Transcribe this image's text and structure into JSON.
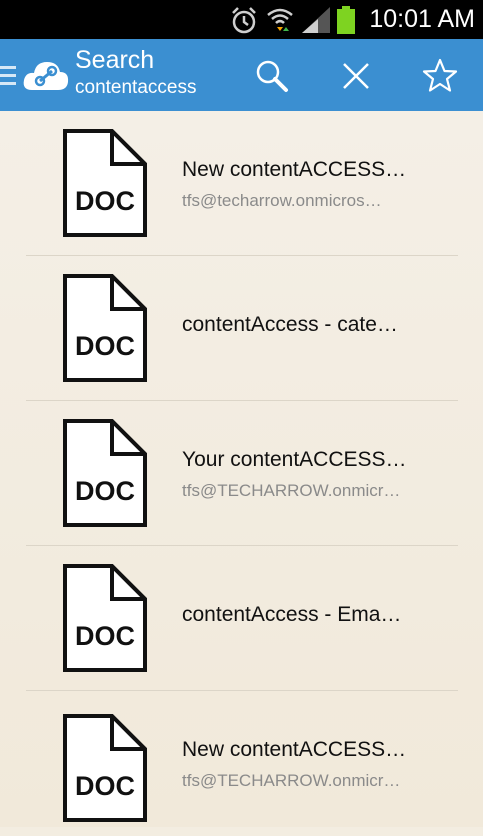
{
  "status_bar": {
    "time": "10:01 AM",
    "icons": [
      "alarm-icon",
      "wifi-icon",
      "signal-icon",
      "battery-icon"
    ]
  },
  "action_bar": {
    "title": "Search",
    "subtitle": "contentaccess",
    "icons": [
      "drawer-icon",
      "app-logo-icon",
      "search-icon",
      "close-icon",
      "star-icon"
    ],
    "colors": {
      "bar": "#3b8fd1"
    }
  },
  "results": [
    {
      "icon_label": "DOC",
      "name": "New contentACCESS…",
      "sender": "tfs@techarrow.onmicros…"
    },
    {
      "icon_label": "DOC",
      "name": "contentAccess - cate…",
      "sender": ""
    },
    {
      "icon_label": "DOC",
      "name": "Your contentACCESS…",
      "sender": "tfs@TECHARROW.onmicr…"
    },
    {
      "icon_label": "DOC",
      "name": "contentAccess - Ema…",
      "sender": ""
    },
    {
      "icon_label": "DOC",
      "name": "New contentACCESS…",
      "sender": "tfs@TECHARROW.onmicr…"
    }
  ]
}
